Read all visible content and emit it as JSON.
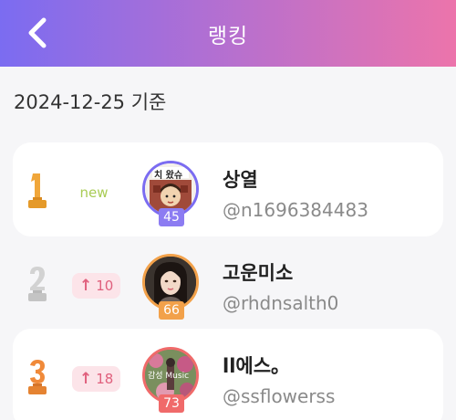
{
  "header": {
    "title": "랭킹"
  },
  "date_label": "2024-12-25 기준",
  "ranking": [
    {
      "rank": 1,
      "change": "new",
      "change_type": "new",
      "level": "45",
      "level_color": "#8c7cf2",
      "name": "상열",
      "handle": "@n1696384483",
      "avatar_note": "치 왔슈"
    },
    {
      "rank": 2,
      "change": "10",
      "change_type": "up",
      "level": "66",
      "level_color": "#f2a14a",
      "name": "고운미소",
      "handle": "@rhdnsalth0"
    },
    {
      "rank": 3,
      "change": "18",
      "change_type": "up",
      "level": "73",
      "level_color": "#f06a6a",
      "name": "ll에스。",
      "handle": "@ssflowerss",
      "avatar_note": "감성 Music"
    }
  ],
  "colors": {
    "gold": "#f0a63a",
    "silver": "#c8c8c8",
    "bronze": "#f08a3a"
  }
}
